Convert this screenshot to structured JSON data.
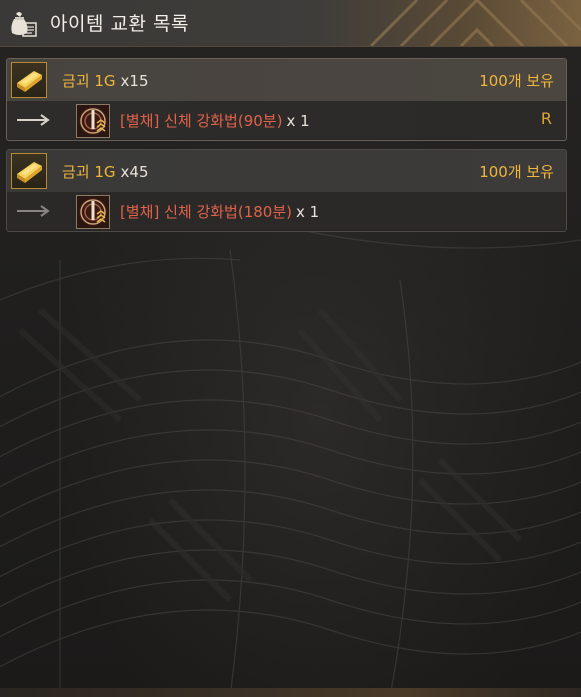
{
  "window": {
    "title": "아이템 교환 목록"
  },
  "entries": [
    {
      "cost_name": "금괴 1G",
      "cost_qty": "x15",
      "owned": "100개 보유",
      "reward_name": "[별채] 신체 강화법(90분)",
      "reward_qty": "x 1",
      "key_hint": "R"
    },
    {
      "cost_name": "금괴 1G",
      "cost_qty": "x45",
      "owned": "100개 보유",
      "reward_name": "[별채] 신체 강화법(180분)",
      "reward_qty": "x 1"
    }
  ],
  "icons": {
    "header": "coin-bag-icon",
    "cost": "gold-bar-icon",
    "arrow": "arrow-right-icon",
    "reward": "skill-book-icon"
  },
  "colors": {
    "gold_text": "#f0b63c",
    "reward_red": "#e0624a",
    "header_text": "#f2eee8"
  }
}
